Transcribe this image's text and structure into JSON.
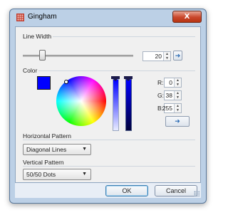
{
  "window": {
    "title": "Gingham",
    "close_label": "X"
  },
  "line_width": {
    "label": "Line Width",
    "value": "20",
    "slider_fraction": 0.18,
    "apply_icon": "apply-arrow-icon"
  },
  "color": {
    "label": "Color",
    "selected_hex": "#0000ff",
    "r_label": "R:",
    "r_value": "0",
    "g_label": "G:",
    "g_value": "38",
    "b_label": "B:",
    "b_value": "255",
    "apply_icon": "apply-arrow-icon"
  },
  "horizontal_pattern": {
    "label": "Horizontal Pattern",
    "selected": "Diagonal Lines"
  },
  "vertical_pattern": {
    "label": "Vertical Pattern",
    "selected": "50/50 Dots"
  },
  "footer": {
    "ok_label": "OK",
    "cancel_label": "Cancel"
  },
  "colors": {
    "frame": "#bcd0e6",
    "client": "#f0f0f0",
    "close": "#c9462b",
    "accent": "#2a6ab3"
  }
}
